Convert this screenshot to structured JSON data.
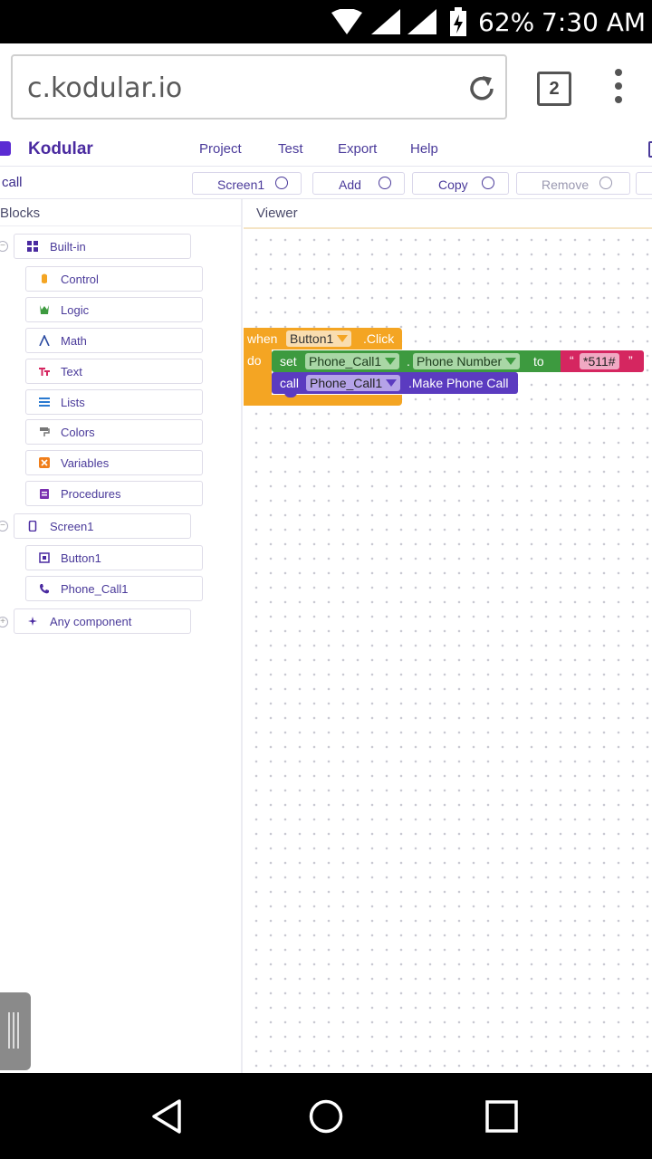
{
  "status_bar": {
    "battery": "62%",
    "time": "7:30 AM"
  },
  "browser": {
    "url": "c.kodular.io",
    "tab_count": "2"
  },
  "app": {
    "name": "Kodular",
    "menu": [
      "Project",
      "Test",
      "Export",
      "Help"
    ]
  },
  "toolbar": {
    "project_name": "call",
    "screen_label": "Screen1",
    "add_label": "Add",
    "copy_label": "Copy",
    "remove_label": "Remove"
  },
  "blocks_panel": {
    "title": "Blocks",
    "builtin_label": "Built-in",
    "builtin_items": [
      "Control",
      "Logic",
      "Math",
      "Text",
      "Lists",
      "Colors",
      "Variables",
      "Procedures"
    ],
    "screen_label": "Screen1",
    "screen_items": [
      "Button1",
      "Phone_Call1"
    ],
    "any_component_label": "Any component"
  },
  "viewer": {
    "title": "Viewer"
  },
  "event_block": {
    "when": "when",
    "component": "Button1",
    "event": ".Click",
    "do": "do",
    "set": "set",
    "set_component": "Phone_Call1",
    "dot": ".",
    "property": "Phone Number",
    "to": "to",
    "quote_open": "“",
    "string_value": "*511#",
    "quote_close": "”",
    "call": "call",
    "call_component": "Phone_Call1",
    "method": ".Make Phone Call"
  },
  "colors": {
    "event_block": "#F4A523",
    "setter_block": "#3D9A3F",
    "method_block": "#5B3BC0",
    "text_block": "#D52660",
    "accent": "#4a2aa0"
  }
}
